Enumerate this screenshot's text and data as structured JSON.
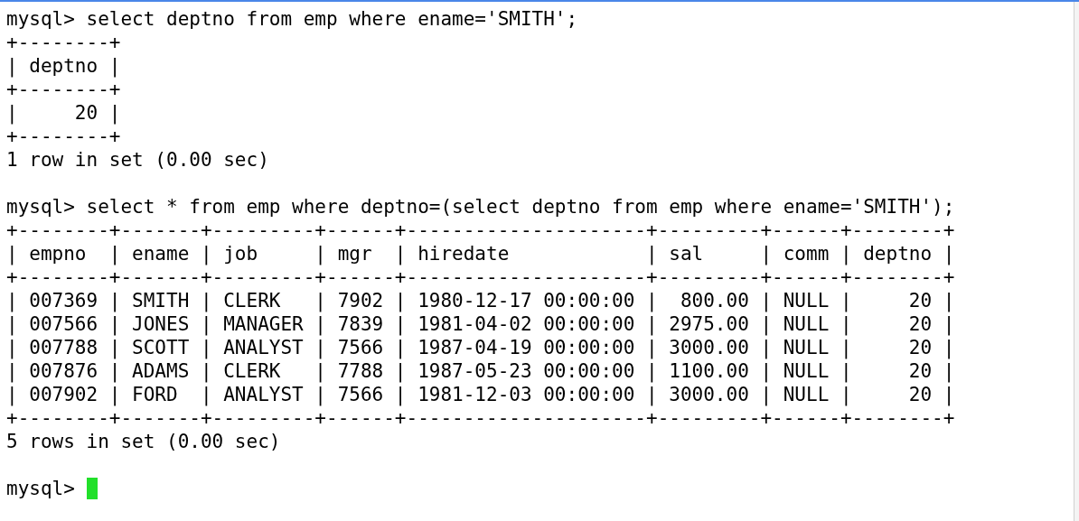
{
  "terminal": {
    "lines": [
      {
        "kind": "text",
        "text": "mysql> select deptno from emp where ename='SMITH';"
      },
      {
        "kind": "text",
        "text": "+--------+"
      },
      {
        "kind": "text",
        "text": "| deptno |"
      },
      {
        "kind": "text",
        "text": "+--------+"
      },
      {
        "kind": "text",
        "text": "|     20 |"
      },
      {
        "kind": "text",
        "text": "+--------+"
      },
      {
        "kind": "text",
        "text": "1 row in set (0.00 sec)"
      },
      {
        "kind": "blank"
      },
      {
        "kind": "text",
        "text": "mysql> select * from emp where deptno=(select deptno from emp where ename='SMITH');"
      },
      {
        "kind": "text",
        "text": "+--------+-------+---------+------+---------------------+---------+------+--------+"
      },
      {
        "kind": "text",
        "text": "| empno  | ename | job     | mgr  | hiredate            | sal     | comm | deptno |"
      },
      {
        "kind": "text",
        "text": "+--------+-------+---------+------+---------------------+---------+------+--------+"
      },
      {
        "kind": "text",
        "text": "| 007369 | SMITH | CLERK   | 7902 | 1980-12-17 00:00:00 |  800.00 | NULL |     20 |"
      },
      {
        "kind": "text",
        "text": "| 007566 | JONES | MANAGER | 7839 | 1981-04-02 00:00:00 | 2975.00 | NULL |     20 |"
      },
      {
        "kind": "text",
        "text": "| 007788 | SCOTT | ANALYST | 7566 | 1987-04-19 00:00:00 | 3000.00 | NULL |     20 |"
      },
      {
        "kind": "text",
        "text": "| 007876 | ADAMS | CLERK   | 7788 | 1987-05-23 00:00:00 | 1100.00 | NULL |     20 |"
      },
      {
        "kind": "text",
        "text": "| 007902 | FORD  | ANALYST | 7566 | 1981-12-03 00:00:00 | 3000.00 | NULL |     20 |"
      },
      {
        "kind": "text",
        "text": "+--------+-------+---------+------+---------------------+---------+------+--------+"
      },
      {
        "kind": "text",
        "text": "5 rows in set (0.00 sec)"
      },
      {
        "kind": "blank"
      },
      {
        "kind": "prompt",
        "text": "mysql>",
        "cursor": true
      }
    ]
  }
}
